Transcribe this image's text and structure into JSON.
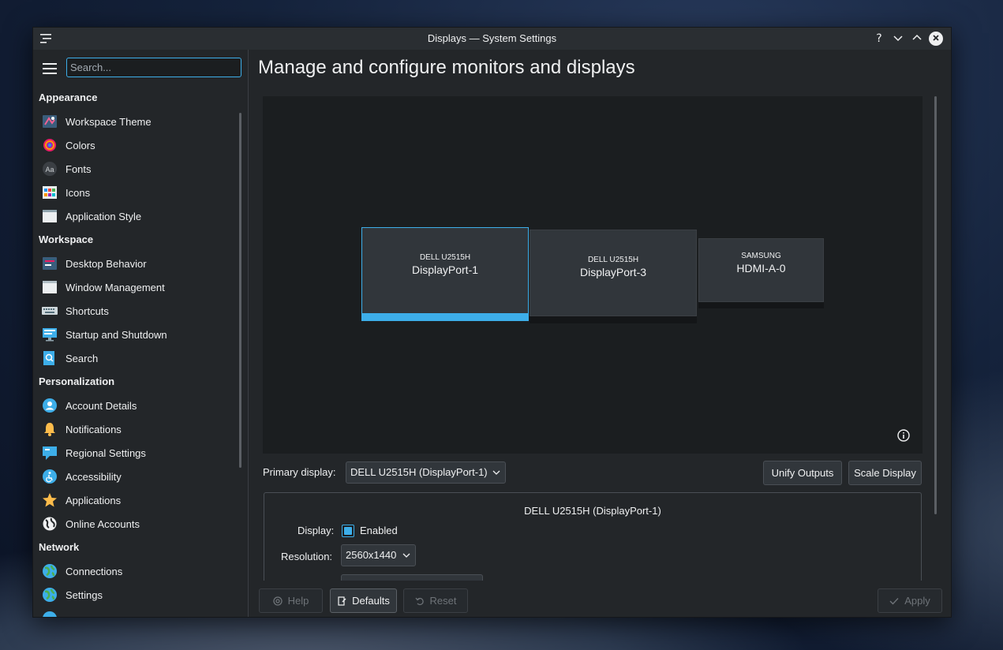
{
  "window": {
    "title": "Displays — System Settings"
  },
  "sidebar": {
    "search_placeholder": "Search...",
    "sections": [
      {
        "heading": "Appearance",
        "items": [
          {
            "label": "Workspace Theme",
            "icon": "workspace-theme-icon"
          },
          {
            "label": "Colors",
            "icon": "colors-icon"
          },
          {
            "label": "Fonts",
            "icon": "fonts-icon"
          },
          {
            "label": "Icons",
            "icon": "icons-icon"
          },
          {
            "label": "Application Style",
            "icon": "application-style-icon"
          }
        ]
      },
      {
        "heading": "Workspace",
        "items": [
          {
            "label": "Desktop Behavior",
            "icon": "desktop-behavior-icon"
          },
          {
            "label": "Window Management",
            "icon": "window-management-icon"
          },
          {
            "label": "Shortcuts",
            "icon": "keyboard-icon"
          },
          {
            "label": "Startup and Shutdown",
            "icon": "monitor-icon"
          },
          {
            "label": "Search",
            "icon": "search-icon"
          }
        ]
      },
      {
        "heading": "Personalization",
        "items": [
          {
            "label": "Account Details",
            "icon": "user-icon"
          },
          {
            "label": "Notifications",
            "icon": "bell-icon"
          },
          {
            "label": "Regional Settings",
            "icon": "chat-flag-icon"
          },
          {
            "label": "Accessibility",
            "icon": "accessibility-icon"
          },
          {
            "label": "Applications",
            "icon": "star-icon"
          },
          {
            "label": "Online Accounts",
            "icon": "globe-icon"
          }
        ]
      },
      {
        "heading": "Network",
        "items": [
          {
            "label": "Connections",
            "icon": "network-globe-icon"
          },
          {
            "label": "Settings",
            "icon": "network-settings-icon"
          }
        ]
      }
    ]
  },
  "main": {
    "title": "Manage and configure monitors and displays",
    "monitors": [
      {
        "model": "DELL U2515H",
        "port": "DisplayPort-1",
        "selected": true
      },
      {
        "model": "DELL U2515H",
        "port": "DisplayPort-3",
        "selected": false
      },
      {
        "model": "SAMSUNG",
        "port": "HDMI-A-0",
        "selected": false
      }
    ],
    "primary_label": "Primary display:",
    "primary_value": "DELL U2515H (DisplayPort-1)",
    "unify_label": "Unify Outputs",
    "scale_label": "Scale Display",
    "output": {
      "title": "DELL U2515H (DisplayPort-1)",
      "display_label": "Display:",
      "enabled_label": "Enabled",
      "enabled": true,
      "resolution_label": "Resolution:",
      "resolution_value": "2560x1440"
    }
  },
  "footer": {
    "help": "Help",
    "defaults": "Defaults",
    "reset": "Reset",
    "apply": "Apply"
  },
  "colors": {
    "accent": "#3daee9",
    "window_bg": "#232629",
    "panel_bg": "#1b1e20"
  }
}
